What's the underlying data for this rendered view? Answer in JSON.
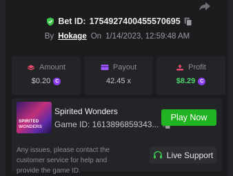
{
  "header": {
    "bet_id_label": "Bet ID:",
    "bet_id": "1754927400455570695",
    "by_label": "By",
    "username": "Hokage",
    "on_label": "On",
    "datetime": "1/14/2023, 12:59:48 AM"
  },
  "stats": [
    {
      "title": "Amount",
      "value": "$0.20",
      "icon": "coins-icon",
      "color": "#e8496a"
    },
    {
      "title": "Payout",
      "value": "42.45 x",
      "icon": "wallet-icon",
      "color": "#9b59f5"
    },
    {
      "title": "Profit",
      "value": "$8.29",
      "icon": "profit-icon",
      "color": "#e8496a"
    }
  ],
  "game": {
    "name": "Spirited Wonders",
    "id_text": "Game ID: 1613896859343...",
    "thumb_line1": "SPIRITED",
    "thumb_line2": "WONDERS",
    "play_label": "Play Now",
    "help_text": "Any issues, please contact the customer service for help and provide the game ID.",
    "support_label": "Live Support"
  },
  "colors": {
    "background": "#1b1c1e",
    "card": "#232427",
    "play_green": "#22b322",
    "profit_green": "#4cd56b",
    "coin_purple": "#8a3ff0",
    "verified_green": "#3cc54a"
  }
}
